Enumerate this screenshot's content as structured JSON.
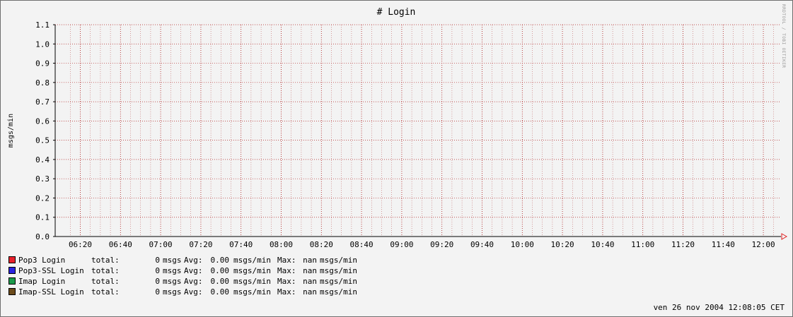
{
  "chart_data": {
    "type": "line",
    "title": "# Login",
    "ylabel": "msgs/min",
    "ylim": [
      0,
      1.1
    ],
    "y_ticks": [
      "0.0",
      "0.1",
      "0.2",
      "0.3",
      "0.4",
      "0.5",
      "0.6",
      "0.7",
      "0.8",
      "0.9",
      "1.0",
      "1.1"
    ],
    "x_ticks": [
      "06:20",
      "06:40",
      "07:00",
      "07:20",
      "07:40",
      "08:00",
      "08:20",
      "08:40",
      "09:00",
      "09:20",
      "09:40",
      "10:00",
      "10:20",
      "10:40",
      "11:00",
      "11:20",
      "11:40",
      "12:00"
    ],
    "grid": true,
    "series": [
      {
        "name": "Pop3 Login",
        "color": "#e8202a",
        "values": []
      },
      {
        "name": "Pop3-SSL Login",
        "color": "#2a22e0",
        "values": []
      },
      {
        "name": "Imap Login",
        "color": "#1a9a4a",
        "values": []
      },
      {
        "name": "Imap-SSL Login",
        "color": "#6b4a1a",
        "values": []
      }
    ]
  },
  "legend": {
    "rows": [
      {
        "name": "Pop3 Login",
        "color": "#e8202a",
        "total_label": "total:",
        "total": "0",
        "total_unit": "msgs",
        "avg_label": "Avg:",
        "avg": "0.00",
        "avg_unit": "msgs/min",
        "max_label": "Max:",
        "max": "nan",
        "max_unit": "msgs/min"
      },
      {
        "name": "Pop3-SSL Login",
        "color": "#2a22e0",
        "total_label": "total:",
        "total": "0",
        "total_unit": "msgs",
        "avg_label": "Avg:",
        "avg": "0.00",
        "avg_unit": "msgs/min",
        "max_label": "Max:",
        "max": "nan",
        "max_unit": "msgs/min"
      },
      {
        "name": "Imap Login",
        "color": "#1a9a4a",
        "total_label": "total:",
        "total": "0",
        "total_unit": "msgs",
        "avg_label": "Avg:",
        "avg": "0.00",
        "avg_unit": "msgs/min",
        "max_label": "Max:",
        "max": "nan",
        "max_unit": "msgs/min"
      },
      {
        "name": "Imap-SSL Login",
        "color": "#6b4a1a",
        "total_label": "total:",
        "total": "0",
        "total_unit": "msgs",
        "avg_label": "Avg:",
        "avg": "0.00",
        "avg_unit": "msgs/min",
        "max_label": "Max:",
        "max": "nan",
        "max_unit": "msgs/min"
      }
    ]
  },
  "timestamp": "ven 26 nov 2004 12:08:05 CET",
  "side_text": "RRDTOOL / TOBI OETIKER",
  "colors": {
    "grid_major": "#b02020",
    "grid_minor": "#c06060",
    "axis": "#000000",
    "arrow": "#e02020"
  }
}
